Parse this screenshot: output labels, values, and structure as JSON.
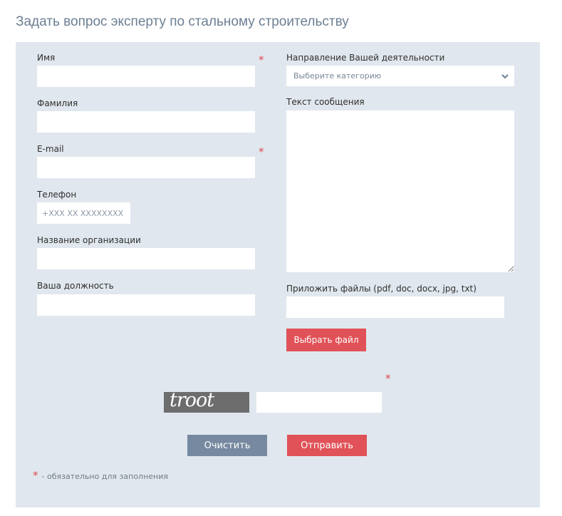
{
  "title": "Задать вопрос эксперту по стальному строительству",
  "fields": {
    "name_label": "Имя",
    "surname_label": "Фамилия",
    "email_label": "E-mail",
    "phone_label": "Телефон",
    "phone_placeholder": "+XXX XX XXXXXXXX",
    "org_label": "Название организации",
    "position_label": "Ваша должность",
    "activity_label": "Направление Вашей деятельности",
    "activity_value": "Выберите категорию",
    "message_label": "Текст сообщения",
    "attach_label": "Приложить файлы (pdf, doc, docx, jpg, txt)",
    "choose_file_button": "Выбрать файл"
  },
  "required_mark": "*",
  "captcha": {
    "text": "troot"
  },
  "buttons": {
    "clear": "Очистить",
    "send": "Отправить"
  },
  "footnote": "- обязательно для заполнения",
  "colors": {
    "panel_bg": "#e1e7ee",
    "accent_red": "#e05258",
    "button_gray": "#7689a0",
    "title_color": "#6c7f93"
  }
}
